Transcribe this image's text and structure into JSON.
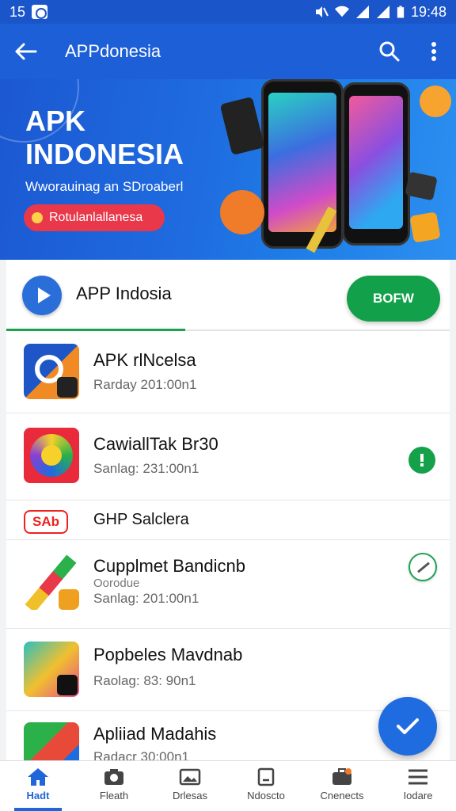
{
  "status_bar": {
    "time_left": "15",
    "time_right": "19:48"
  },
  "app_bar": {
    "title": "APPdonesia"
  },
  "banner": {
    "title_line1": "APK",
    "title_line2": "INDONESIA",
    "subtitle": "Wworauinag an SDroaberl",
    "pill_label": "Rotulanlallanesa"
  },
  "header": {
    "app_name": "APP Indosia",
    "button_label": "BOFW"
  },
  "list": [
    {
      "title": "APK  rlNcelsa",
      "subtitle": "Rarday 201:00n1"
    },
    {
      "title": "CawiallTak Br30",
      "subtitle": "Sanlag: 231:00n1"
    },
    {
      "tag": "SAb",
      "title": "GHP Salclera"
    },
    {
      "title": "Cupplmet Bandicnb",
      "extra": "Oorodue",
      "subtitle": "Sanlag: 201:00n1"
    },
    {
      "title": "Popbeles Mavdnab",
      "subtitle": "Raolag: 83: 90n1"
    },
    {
      "title": "Apliiad Madahis",
      "subtitle": "Radacr 30:00n1"
    }
  ],
  "bottom_nav": [
    {
      "label": "Hadt",
      "icon": "home-icon",
      "active": true
    },
    {
      "label": "Fleath",
      "icon": "camera-icon"
    },
    {
      "label": "Drlesas",
      "icon": "gallery-icon"
    },
    {
      "label": "Ndoscto",
      "icon": "note-icon"
    },
    {
      "label": "Cnenects",
      "icon": "briefcase-icon"
    },
    {
      "label": "Iodare",
      "icon": "menu-icon"
    }
  ],
  "colors": {
    "primary": "#1d5fd6",
    "accent_green": "#12a04a",
    "red": "#e8384a"
  }
}
